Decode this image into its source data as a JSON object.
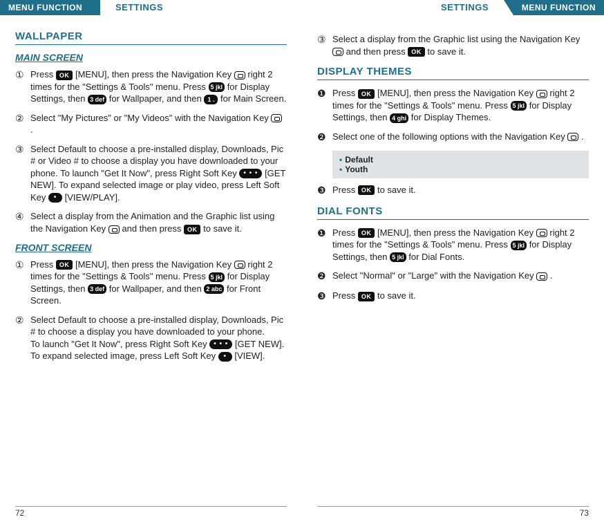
{
  "header": {
    "tab_left": "MENU FUNCTION",
    "tab_right": "MENU FUNCTION",
    "section_left": "SETTINGS",
    "section_right": "SETTINGS"
  },
  "footer": {
    "page_left": "72",
    "page_right": "73"
  },
  "keys": {
    "ok": "OK",
    "five": "5 jkl",
    "three": "3 def",
    "one": "1 .",
    "two": "2 abc",
    "four": "4 ghi",
    "dots3": "• • •",
    "dot1": "•"
  },
  "left": {
    "wallpaper": {
      "title": "WALLPAPER",
      "main_screen": {
        "title": "MAIN SCREEN",
        "steps": {
          "s1a": "Press ",
          "s1b": " [MENU], then press the Navigation Key ",
          "s1c": " right 2 times for the \"Settings & Tools\" menu. Press ",
          "s1d": " for Display Settings, then ",
          "s1e": " for Wallpaper, and then ",
          "s1f": " for Main Screen.",
          "s2a": "Select \"My Pictures\" or \"My Videos\" with the Navigation Key ",
          "s2b": " .",
          "s3": "Select Default to choose a pre-installed display, Downloads, Pic # or Video # to choose a display you have downloaded to your phone. To launch \"Get It Now\", press Right Soft Key ",
          "s3b": " [GET NEW]. To expand selected image or play video, press Left Soft Key ",
          "s3c": " [VIEW/PLAY].",
          "s4a": "Select a display from the Animation and the Graphic list using the Navigation Key ",
          "s4b": " and then press ",
          "s4c": " to save it."
        }
      },
      "front_screen": {
        "title": "FRONT SCREEN",
        "steps": {
          "s1a": "Press ",
          "s1b": " [MENU], then press the Navigation Key ",
          "s1c": " right 2 times for the \"Settings & Tools\" menu. Press ",
          "s1d": " for Display Settings, then ",
          "s1e": " for Wallpaper, and then ",
          "s1f": " for Front Screen.",
          "s2a": "Select Default to choose a pre-installed display, Downloads, Pic # to choose a display you have downloaded to your phone.",
          "s2b": "To launch \"Get It Now\", press Right Soft Key ",
          "s2c": " [GET NEW]. To expand selected image, press Left Soft Key ",
          "s2d": " [VIEW]."
        }
      }
    }
  },
  "right": {
    "wallpaper_cont": {
      "s3a": "Select a display from the Graphic list using the Navigation Key ",
      "s3b": " and then press ",
      "s3c": " to save it."
    },
    "display_themes": {
      "title": "DISPLAY THEMES",
      "s1a": "Press ",
      "s1b": " [MENU], then press the Navigation Key ",
      "s1c": " right 2 times for the \"Settings & Tools\" menu. Press ",
      "s1d": " for Display Settings, then ",
      "s1e": " for Display Themes.",
      "s2a": "Select one of the following options with the Navigation Key ",
      "s2b": " .",
      "options": {
        "o1": "Default",
        "o2": "Youth"
      },
      "s3a": "Press ",
      "s3b": " to save it."
    },
    "dial_fonts": {
      "title": "DIAL FONTS",
      "s1a": "Press ",
      "s1b": " [MENU], then press the Navigation Key ",
      "s1c": " right 2 times for the \"Settings & Tools\" menu. Press ",
      "s1d": " for Display Settings, then ",
      "s1e": " for Dial Fonts.",
      "s2a": "Select \"Normal\" or \"Large\" with the Navigation Key ",
      "s2b": " .",
      "s3a": "Press ",
      "s3b": " to save it."
    }
  }
}
